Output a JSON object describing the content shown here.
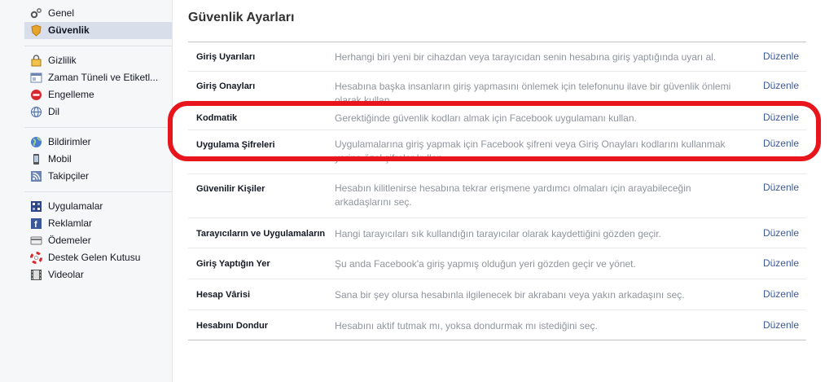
{
  "sidebar": {
    "groups": [
      [
        {
          "label": "Genel",
          "icon": "gear-icon"
        },
        {
          "label": "Güvenlik",
          "icon": "shield-icon",
          "active": true
        }
      ],
      [
        {
          "label": "Gizlilik",
          "icon": "lock-icon"
        },
        {
          "label": "Zaman Tüneli ve Etiketl...",
          "icon": "timeline-icon"
        },
        {
          "label": "Engelleme",
          "icon": "block-icon"
        },
        {
          "label": "Dil",
          "icon": "globe-icon"
        }
      ],
      [
        {
          "label": "Bildirimler",
          "icon": "world-icon"
        },
        {
          "label": "Mobil",
          "icon": "mobile-icon"
        },
        {
          "label": "Takipçiler",
          "icon": "rss-icon"
        }
      ],
      [
        {
          "label": "Uygulamalar",
          "icon": "apps-icon"
        },
        {
          "label": "Reklamlar",
          "icon": "ads-icon"
        },
        {
          "label": "Ödemeler",
          "icon": "card-icon"
        },
        {
          "label": "Destek Gelen Kutusu",
          "icon": "lifebuoy-icon"
        },
        {
          "label": "Videolar",
          "icon": "film-icon"
        }
      ]
    ]
  },
  "main": {
    "title": "Güvenlik Ayarları",
    "edit_label": "Düzenle",
    "rows": [
      {
        "label": "Giriş Uyarıları",
        "desc": "Herhangi biri yeni bir cihazdan veya tarayıcıdan senin hesabına giriş yaptığında uyarı al."
      },
      {
        "label": "Giriş Onayları",
        "desc": "Hesabına başka insanların giriş yapmasını önlemek için telefonunu ilave bir güvenlik önlemi olarak kullan."
      },
      {
        "label": "Kodmatik",
        "desc": "Gerektiğinde güvenlik kodları almak için Facebook uygulamanı kullan."
      },
      {
        "label": "Uygulama Şifreleri",
        "desc": "Uygulamalarına giriş yapmak için Facebook şifreni veya Giriş Onayları kodlarını kullanmak yerine özel şifreler kullan."
      },
      {
        "label": "Güvenilir Kişiler",
        "desc": "Hesabın kilitlenirse hesabına tekrar erişmene yardımcı olmaları için arayabileceğin arkadaşlarını seç."
      },
      {
        "label": "Tarayıcıların ve Uygulamaların",
        "desc": "Hangi tarayıcıları sık kullandığın tarayıcılar olarak kaydettiğini gözden geçir."
      },
      {
        "label": "Giriş Yaptığın Yer",
        "desc": "Şu anda Facebook'a giriş yapmış olduğun yeri gözden geçir ve yönet."
      },
      {
        "label": "Hesap Vârisi",
        "desc": "Sana bir şey olursa hesabınla ilgilenecek bir akrabanı veya yakın arkadaşını seç."
      },
      {
        "label": "Hesabını Dondur",
        "desc": "Hesabını aktif tutmak mı, yoksa dondurmak mı istediğini seç."
      }
    ]
  },
  "colors": {
    "link": "#3b5998",
    "highlight": "#e8151c",
    "active_bg": "#d8dfea"
  }
}
